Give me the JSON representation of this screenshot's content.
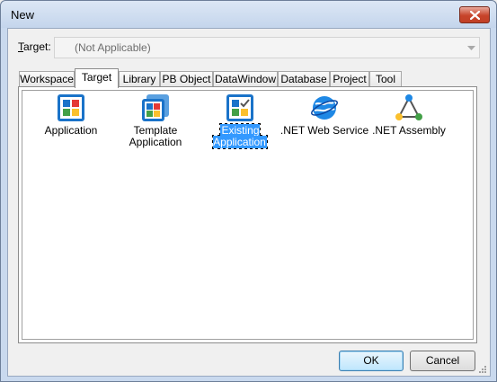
{
  "window": {
    "title": "New"
  },
  "target": {
    "label_prefix": "",
    "label_accel": "T",
    "label_rest": "arget:",
    "value": "(Not Applicable)"
  },
  "tabs": [
    {
      "label": "Workspace",
      "active": false
    },
    {
      "label": "Target",
      "active": true
    },
    {
      "label": "Library",
      "active": false
    },
    {
      "label": "PB Object",
      "active": false
    },
    {
      "label": "DataWindow",
      "active": false
    },
    {
      "label": "Database",
      "active": false
    },
    {
      "label": "Project",
      "active": false
    },
    {
      "label": "Tool",
      "active": false
    }
  ],
  "items": [
    {
      "label": "Application",
      "icon": "application-icon",
      "selected": false
    },
    {
      "label_line1": "Template",
      "label_line2": "Application",
      "icon": "template-application-icon",
      "selected": false
    },
    {
      "label": "Existing Application",
      "icon": "existing-application-icon",
      "selected": true
    },
    {
      "label": ".NET Web Service",
      "icon": "net-web-service-icon",
      "selected": false
    },
    {
      "label": ".NET Assembly",
      "icon": "net-assembly-icon",
      "selected": false
    }
  ],
  "buttons": {
    "ok": "OK",
    "cancel": "Cancel"
  },
  "colors": {
    "selection": "#3399ff",
    "icon_blue": "#1a73c9",
    "icon_red": "#e53935",
    "icon_green": "#43a047",
    "icon_yellow": "#fbc02d"
  }
}
